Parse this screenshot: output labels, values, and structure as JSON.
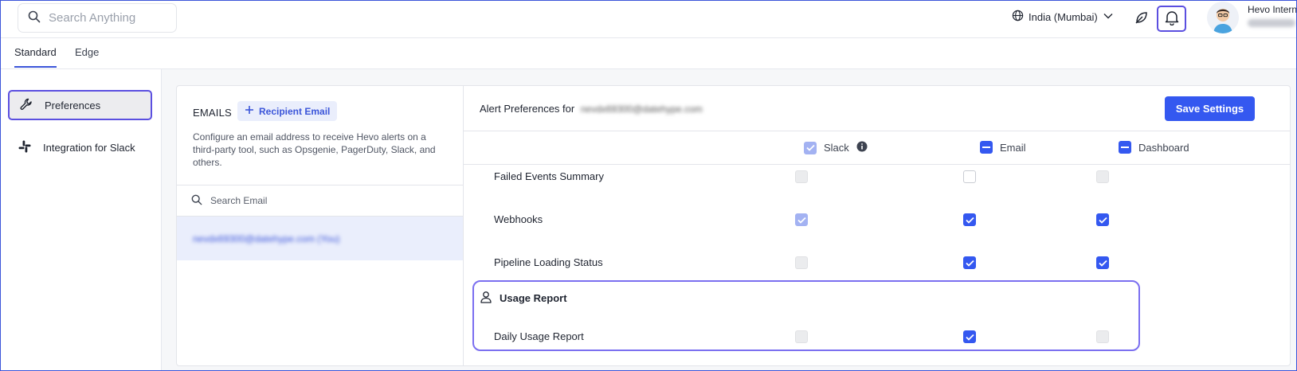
{
  "header": {
    "search_placeholder": "Search Anything",
    "region": "India (Mumbai)",
    "user_name": "Hevo Intern"
  },
  "tabs": [
    {
      "label": "Standard",
      "active": true
    },
    {
      "label": "Edge",
      "active": false
    }
  ],
  "sidebar": {
    "items": [
      {
        "label": "Preferences",
        "icon": "wrench-icon",
        "active": true
      },
      {
        "label": "Integration for Slack",
        "icon": "slack-icon",
        "active": false
      }
    ]
  },
  "emails": {
    "title": "EMAILS",
    "add_button": "Recipient Email",
    "description": "Configure an email address to receive Hevo alerts on a third-party tool, such as Opsgenie, PagerDuty, Slack, and others.",
    "search_placeholder": "Search Email",
    "selected_email": "nevdx69300@datehype.com (You)"
  },
  "preferences": {
    "title_prefix": "Alert Preferences for",
    "title_email": "nevdx69300@datehype.com",
    "save_button": "Save Settings",
    "columns": {
      "slack": "Slack",
      "email": "Email",
      "dashboard": "Dashboard"
    },
    "rows": [
      {
        "label": "Failed Events Summary",
        "slack": "disabled",
        "email": "off",
        "dashboard": "disabled"
      },
      {
        "label": "Webhooks",
        "slack": "checked-light",
        "email": "checked",
        "dashboard": "checked"
      },
      {
        "label": "Pipeline Loading Status",
        "slack": "disabled",
        "email": "checked",
        "dashboard": "checked"
      }
    ],
    "usage_section": {
      "title": "Usage Report",
      "rows": [
        {
          "label": "Daily Usage Report",
          "slack": "disabled",
          "email": "checked",
          "dashboard": "disabled"
        }
      ]
    }
  },
  "colors": {
    "primary": "#3458f0",
    "focus_outline": "#5b4fe0",
    "selected_bg": "#eaeefc"
  }
}
